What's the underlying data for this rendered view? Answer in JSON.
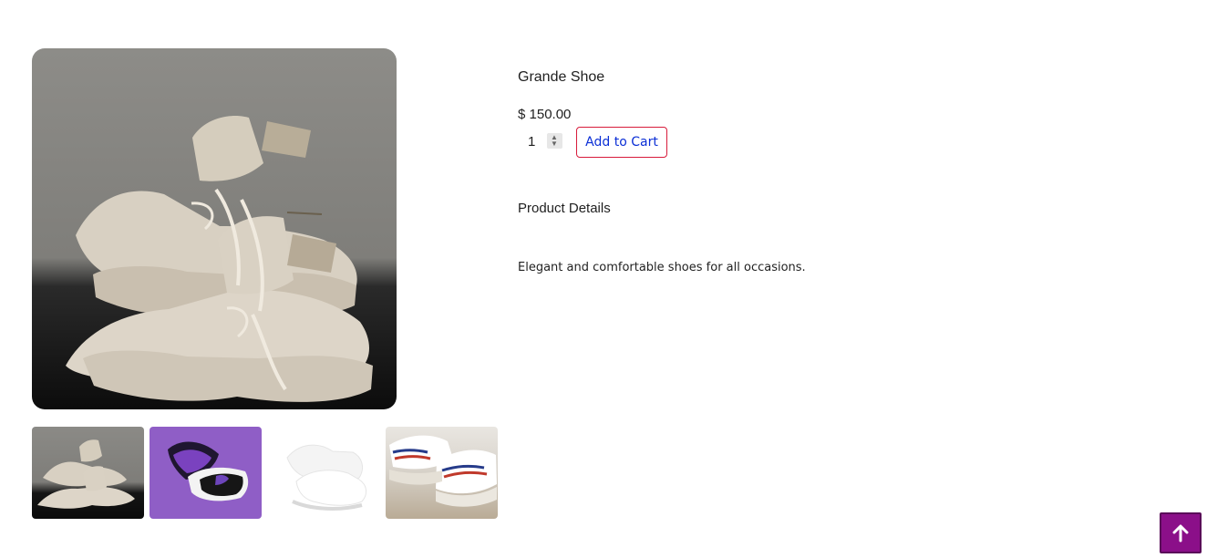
{
  "product": {
    "title": "Grande Shoe",
    "price": "$ 150.00",
    "quantity": "1",
    "add_to_cart_label": "Add to Cart",
    "details_heading": "Product Details",
    "description": "Elegant and comfortable shoes for all occasions."
  },
  "gallery": {
    "main_image": "beige-high-top-sneakers-photo",
    "thumbnails": [
      {
        "name": "beige-high-top-sneakers-thumbnail",
        "background": "#7e7d79"
      },
      {
        "name": "purple-high-top-sneakers-thumbnail",
        "background": "#8f5ec6"
      },
      {
        "name": "white-chunky-sneakers-thumbnail",
        "background": "#ffffff"
      },
      {
        "name": "white-striped-sneakers-thumbnail",
        "background": "#d9d4cc"
      }
    ]
  },
  "scroll_top": {
    "icon": "arrow-up-icon",
    "color": "#8b0f89"
  }
}
